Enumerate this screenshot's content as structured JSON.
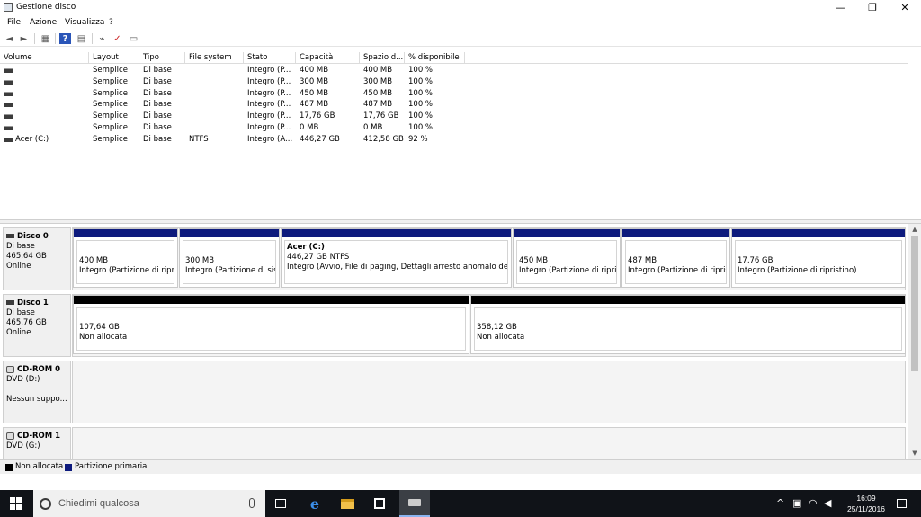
{
  "window": {
    "title": "Gestione disco",
    "minimize": "—",
    "restore": "❐",
    "close": "✕"
  },
  "menu": [
    "File",
    "Azione",
    "Visualizza",
    "?"
  ],
  "toolbar": {
    "back": "◄",
    "forward": "►",
    "console": "▦",
    "help": "?",
    "properties": "▤",
    "connect": "⌁",
    "check": "✓",
    "options": "▭"
  },
  "volume_table": {
    "headers": [
      "Volume",
      "Layout",
      "Tipo",
      "File system",
      "Stato",
      "Capacità",
      "Spazio d...",
      "% disponibile"
    ],
    "rows": [
      [
        "",
        "Semplice",
        "Di base",
        "",
        "Integro (P...",
        "400 MB",
        "400 MB",
        "100 %"
      ],
      [
        "",
        "Semplice",
        "Di base",
        "",
        "Integro (P...",
        "300 MB",
        "300 MB",
        "100 %"
      ],
      [
        "",
        "Semplice",
        "Di base",
        "",
        "Integro (P...",
        "450 MB",
        "450 MB",
        "100 %"
      ],
      [
        "",
        "Semplice",
        "Di base",
        "",
        "Integro (P...",
        "487 MB",
        "487 MB",
        "100 %"
      ],
      [
        "",
        "Semplice",
        "Di base",
        "",
        "Integro (P...",
        "17,76 GB",
        "17,76 GB",
        "100 %"
      ],
      [
        "",
        "Semplice",
        "Di base",
        "",
        "Integro (P...",
        "0 MB",
        "0 MB",
        "100 %"
      ],
      [
        "Acer (C:)",
        "Semplice",
        "Di base",
        "NTFS",
        "Integro (A...",
        "446,27 GB",
        "412,58 GB",
        "92 %"
      ]
    ]
  },
  "disks": [
    {
      "name": "Disco 0",
      "type": "Di base",
      "size": "465,64 GB",
      "status": "Online",
      "partitions": [
        {
          "name": "",
          "size": "400 MB",
          "desc": "Integro (Partizione di riprist"
        },
        {
          "name": "",
          "size": "300 MB",
          "desc": "Integro (Partizione di siste"
        },
        {
          "name": "Acer  (C:)",
          "size": "446,27 GB NTFS",
          "desc": "Integro (Avvio, File di paging, Dettagli arresto anomalo del sist"
        },
        {
          "name": "",
          "size": "450 MB",
          "desc": "Integro (Partizione di ripristi"
        },
        {
          "name": "",
          "size": "487 MB",
          "desc": "Integro (Partizione di ripristi"
        },
        {
          "name": "",
          "size": "17,76 GB",
          "desc": "Integro (Partizione di ripristino)"
        }
      ]
    },
    {
      "name": "Disco 1",
      "type": "Di base",
      "size": "465,76 GB",
      "status": "Online",
      "partitions": [
        {
          "size": "107,64 GB",
          "desc": "Non allocata"
        },
        {
          "size": "358,12 GB",
          "desc": "Non allocata"
        }
      ]
    },
    {
      "name": "CD-ROM 0",
      "type": "DVD (D:)",
      "status": "Nessun suppo..."
    },
    {
      "name": "CD-ROM 1",
      "type": "DVD (G:)"
    }
  ],
  "legend": [
    {
      "label": "Non allocata",
      "color": "#000000"
    },
    {
      "label": "Partizione primaria",
      "color": "#0d1a7d"
    }
  ],
  "taskbar": {
    "search_placeholder": "Chiedimi qualcosa",
    "time": "16:09",
    "date": "25/11/2016",
    "start_icon": "windows-logo"
  }
}
